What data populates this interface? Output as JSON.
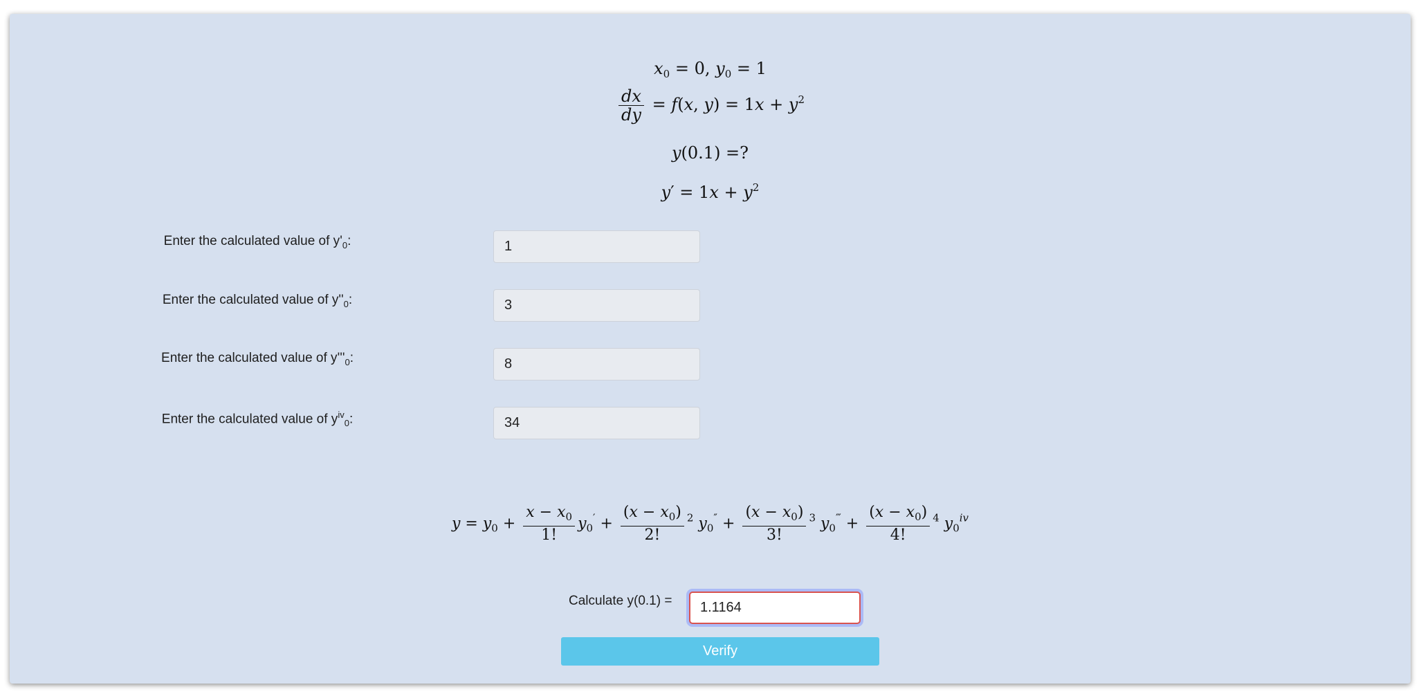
{
  "problem": {
    "initial_condition": "x0 = 0, y0 = 1",
    "differential_equation": "dx/dy = f(x,y) = 1x + y^2",
    "target": "y(0.1) =?",
    "derivative": "y' = 1x + y^2"
  },
  "derivatives_form": {
    "rows": [
      {
        "label_prefix": "Enter the calculated value of y",
        "label_mark": "'",
        "label_sub": "0",
        "label_suffix": ":",
        "value": "1"
      },
      {
        "label_prefix": "Enter the calculated value of y",
        "label_mark": "''",
        "label_sub": "0",
        "label_suffix": ":",
        "value": "3"
      },
      {
        "label_prefix": "Enter the calculated value of y",
        "label_mark": "'''",
        "label_sub": "0",
        "label_suffix": ":",
        "value": "8"
      },
      {
        "label_prefix": "Enter the calculated value of y",
        "label_mark": "iv",
        "label_sub": "0",
        "label_suffix": ":",
        "value": "34"
      }
    ]
  },
  "taylor_formula": "y = y0 + (x - x0)/1! y0' + (x - x0)^2/2! y0'' + (x - x0)^3/3! y0''' + (x - x0)^4/4! y0^iv",
  "calculation": {
    "label": "Calculate y(0.1) =",
    "value": "1.1164"
  },
  "verify_label": "Verify",
  "colors": {
    "panel_background": "#d6e0ef",
    "input_background": "#e8ebf0",
    "verify_button": "#5bc6ea",
    "error_border": "#d9534f"
  }
}
